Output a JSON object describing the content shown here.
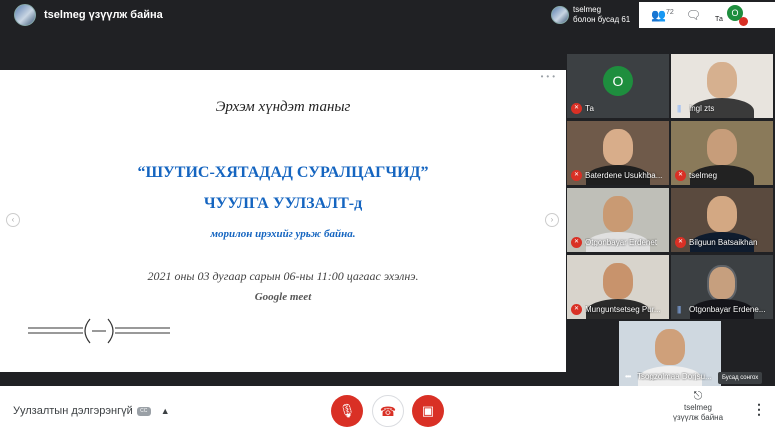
{
  "topbar": {
    "presenter_label": "tselmeg үзүүлж байна",
    "right_presenter_line1": "tselmeg",
    "right_presenter_line2": "болон бусад 61",
    "participants_count": "72",
    "self_label": "Та",
    "self_initial": "O"
  },
  "slide": {
    "line1": "Эрхэм хүндэт таныг",
    "line2": "“ШУТИС-ХЯТАДАД СУРАЛЦАГЧИД”",
    "line3": "ЧУУЛГА УУЛЗАЛТ-д",
    "line4": "морилон ирэхийг урьж байна.",
    "line5": "2021 оны 03 дугаар сарын 06-ны 11:00 цагаас эхэлнэ.",
    "line6": "Google meet"
  },
  "tiles": [
    {
      "name": "Та",
      "initial": "O",
      "mic": "off"
    },
    {
      "name": "Ingl zts",
      "mic": "speaking"
    },
    {
      "name": "Baterdene Usukhba...",
      "mic": "off"
    },
    {
      "name": "tselmeg",
      "mic": "off"
    },
    {
      "name": "Otgonbayar Erdenet",
      "mic": "off"
    },
    {
      "name": "Bilguun Batsaikhan",
      "mic": "off"
    },
    {
      "name": "Munguntsetseg Pur...",
      "mic": "off"
    },
    {
      "name": "Otgonbayar Erdene...",
      "mic": "speaking"
    },
    {
      "name": "Tsogzolmaa Dorjsu...",
      "mic": "more"
    }
  ],
  "other_button": "Бусад сонгох",
  "bottombar": {
    "details_label": "Уулзалтын дэлгэрэнгүй",
    "present_line1": "tselmeg",
    "present_line2": "үзүүлж байна"
  },
  "colors": {
    "accent_red": "#d93025",
    "avatar_green": "#1e8e3e",
    "slide_blue": "#1565c0"
  }
}
